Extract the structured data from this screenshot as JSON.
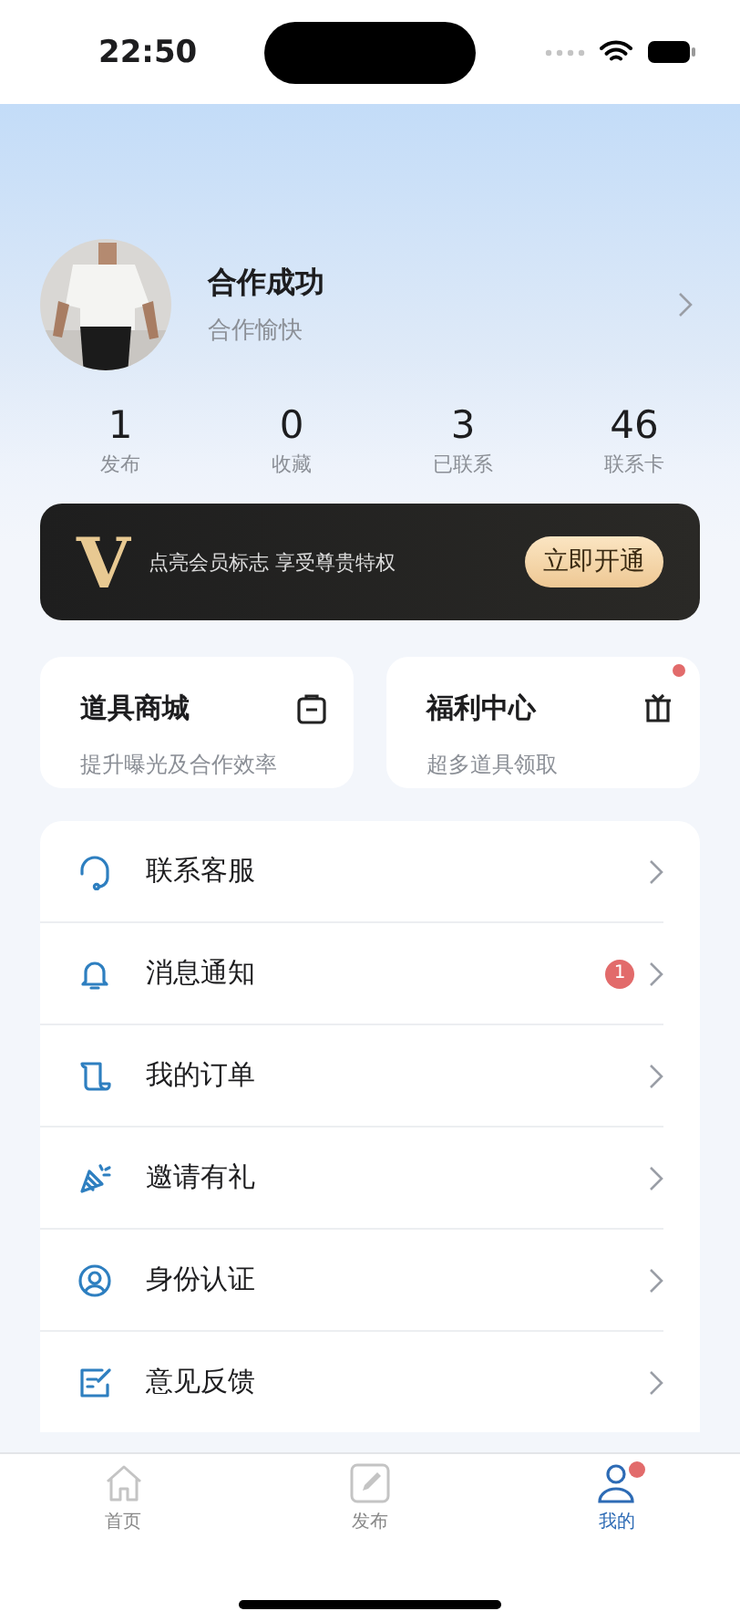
{
  "status_bar": {
    "time": "22:50"
  },
  "profile": {
    "name": "合作成功",
    "subtitle": "合作愉快"
  },
  "stats": [
    {
      "value": "1",
      "label": "发布"
    },
    {
      "value": "0",
      "label": "收藏"
    },
    {
      "value": "3",
      "label": "已联系"
    },
    {
      "value": "46",
      "label": "联系卡"
    }
  ],
  "vip": {
    "logo": "V",
    "text": "点亮会员标志 享受尊贵特权",
    "button": "立即开通"
  },
  "shortcuts": [
    {
      "title": "道具商城",
      "subtitle": "提升曝光及合作效率",
      "dot": false
    },
    {
      "title": "福利中心",
      "subtitle": "超多道具领取",
      "dot": true
    }
  ],
  "menu": [
    {
      "label": "联系客服"
    },
    {
      "label": "消息通知",
      "badge": "1"
    },
    {
      "label": "我的订单"
    },
    {
      "label": "邀请有礼"
    },
    {
      "label": "身份认证"
    },
    {
      "label": "意见反馈"
    }
  ],
  "tabs": [
    {
      "label": "首页",
      "selected": false,
      "dot": false
    },
    {
      "label": "发布",
      "selected": false,
      "dot": false
    },
    {
      "label": "我的",
      "selected": true,
      "dot": true
    }
  ]
}
